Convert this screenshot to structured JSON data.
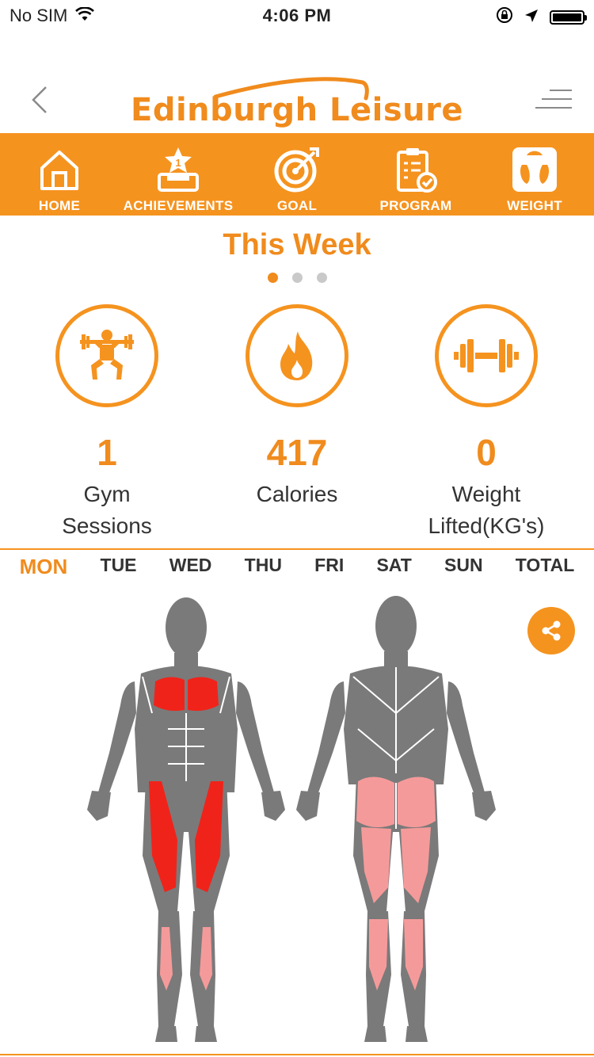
{
  "status_bar": {
    "carrier": "No SIM",
    "time": "4:06 PM"
  },
  "header": {
    "logo_text": "Edinburgh Leisure"
  },
  "nav": [
    {
      "label": "HOME",
      "icon": "home-icon"
    },
    {
      "label": "ACHIEVEMENTS",
      "icon": "trophy-icon"
    },
    {
      "label": "GOAL",
      "icon": "target-icon"
    },
    {
      "label": "PROGRAM",
      "icon": "clipboard-icon"
    },
    {
      "label": "WEIGHT",
      "icon": "scale-icon"
    }
  ],
  "this_week": {
    "title": "This Week",
    "stats": [
      {
        "value": "1",
        "label_line1": "Gym",
        "label_line2": "Sessions",
        "icon": "weightlifter-icon"
      },
      {
        "value": "417",
        "label_line1": "Calories",
        "label_line2": "",
        "icon": "flame-icon"
      },
      {
        "value": "0",
        "label_line1": "Weight",
        "label_line2": "Lifted(KG's)",
        "icon": "dumbbell-icon"
      }
    ],
    "page_count": 3,
    "active_page": 1
  },
  "days": [
    "MON",
    "TUE",
    "WED",
    "THU",
    "FRI",
    "SAT",
    "SUN",
    "TOTAL"
  ],
  "active_day": "MON",
  "colors": {
    "accent": "#f5931f",
    "muscle_high": "#f0231a",
    "muscle_low": "#f59a9a",
    "muscle_none": "#7a7a7a"
  },
  "icons": {
    "back": "chevron-left-icon",
    "menu": "hamburger-menu-icon",
    "share": "share-icon"
  }
}
